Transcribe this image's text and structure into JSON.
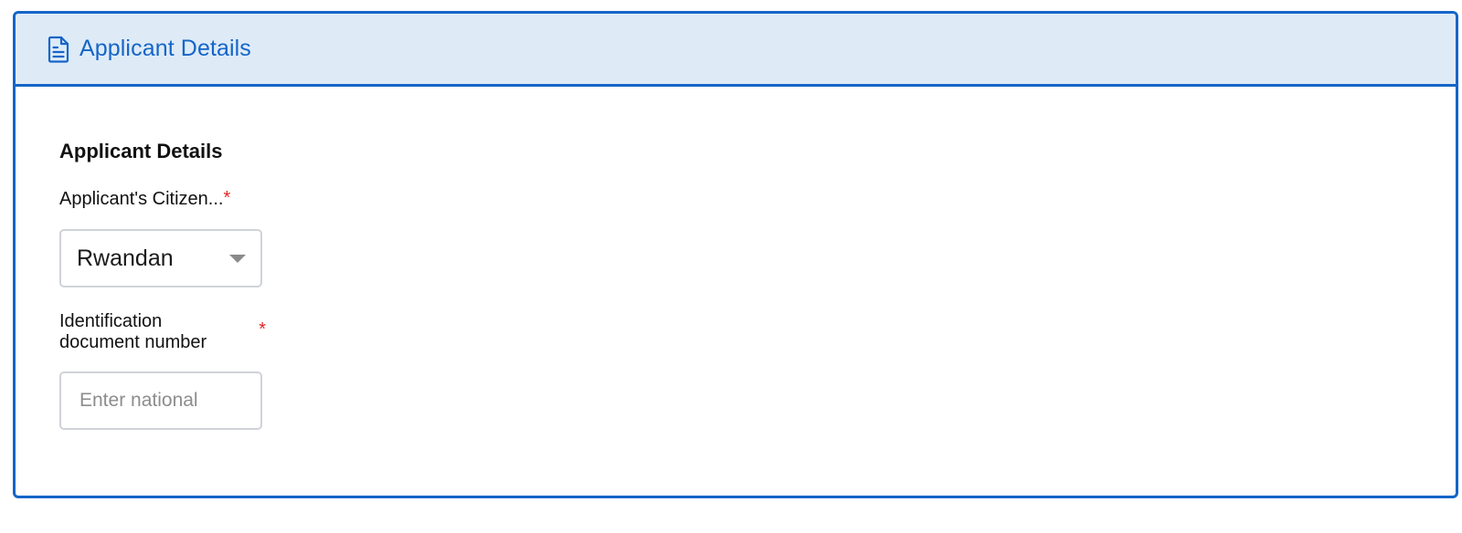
{
  "header": {
    "title": "Applicant Details",
    "icon": "document-icon",
    "accent_color": "#1565c8",
    "background_color": "#deebf7"
  },
  "section": {
    "title": "Applicant Details"
  },
  "citizenship_field": {
    "label": "Applicant's Citizen...",
    "required_marker": "*",
    "selected_value": "Rwandan"
  },
  "id_field": {
    "label_line1": "Identification",
    "label_line2": "document number",
    "required_marker": "*",
    "placeholder": "Enter national",
    "value": ""
  }
}
